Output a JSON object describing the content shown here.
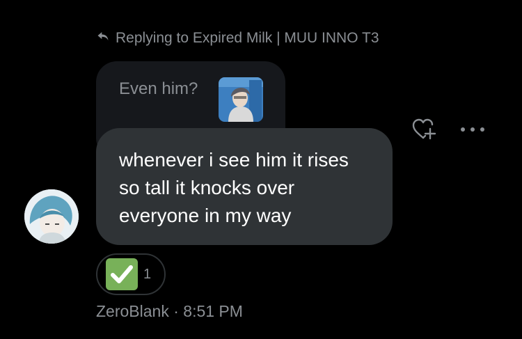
{
  "reply": {
    "label": "Replying to Expired Milk | MUU INNO T3"
  },
  "quoted_message": {
    "text": "Even him?"
  },
  "message": {
    "text": "whenever i see him it rises\nso tall it knocks over\neveryone in my way"
  },
  "reaction": {
    "emoji_icon": "white-check-mark-icon",
    "count": "1"
  },
  "meta": {
    "author": "ZeroBlank",
    "separator": " · ",
    "time": "8:51 PM"
  },
  "colors": {
    "background": "#000000",
    "bubble": "#2f3336",
    "quoted_bubble": "#16181c",
    "muted_text": "#8b8f94",
    "check_green": "#78b159"
  }
}
